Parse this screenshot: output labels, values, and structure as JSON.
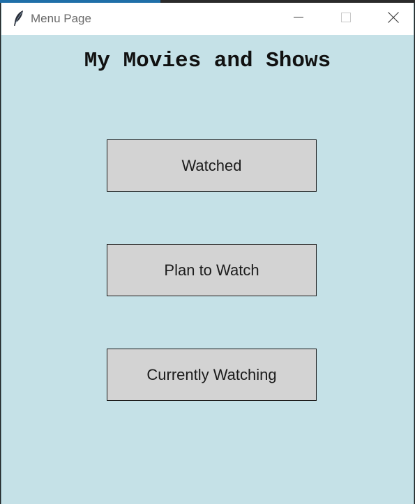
{
  "window": {
    "title": "Menu Page",
    "icon": "feather-icon",
    "controls": {
      "minimize": "minimize-icon",
      "maximize": "maximize-icon",
      "close": "close-icon"
    }
  },
  "colors": {
    "background": "#c5e1e7",
    "button_face": "#d3d3d3",
    "titlebar": "#ffffff"
  },
  "main": {
    "heading": "My Movies and Shows",
    "buttons": [
      {
        "label": "Watched"
      },
      {
        "label": "Plan to Watch"
      },
      {
        "label": "Currently Watching"
      }
    ]
  }
}
